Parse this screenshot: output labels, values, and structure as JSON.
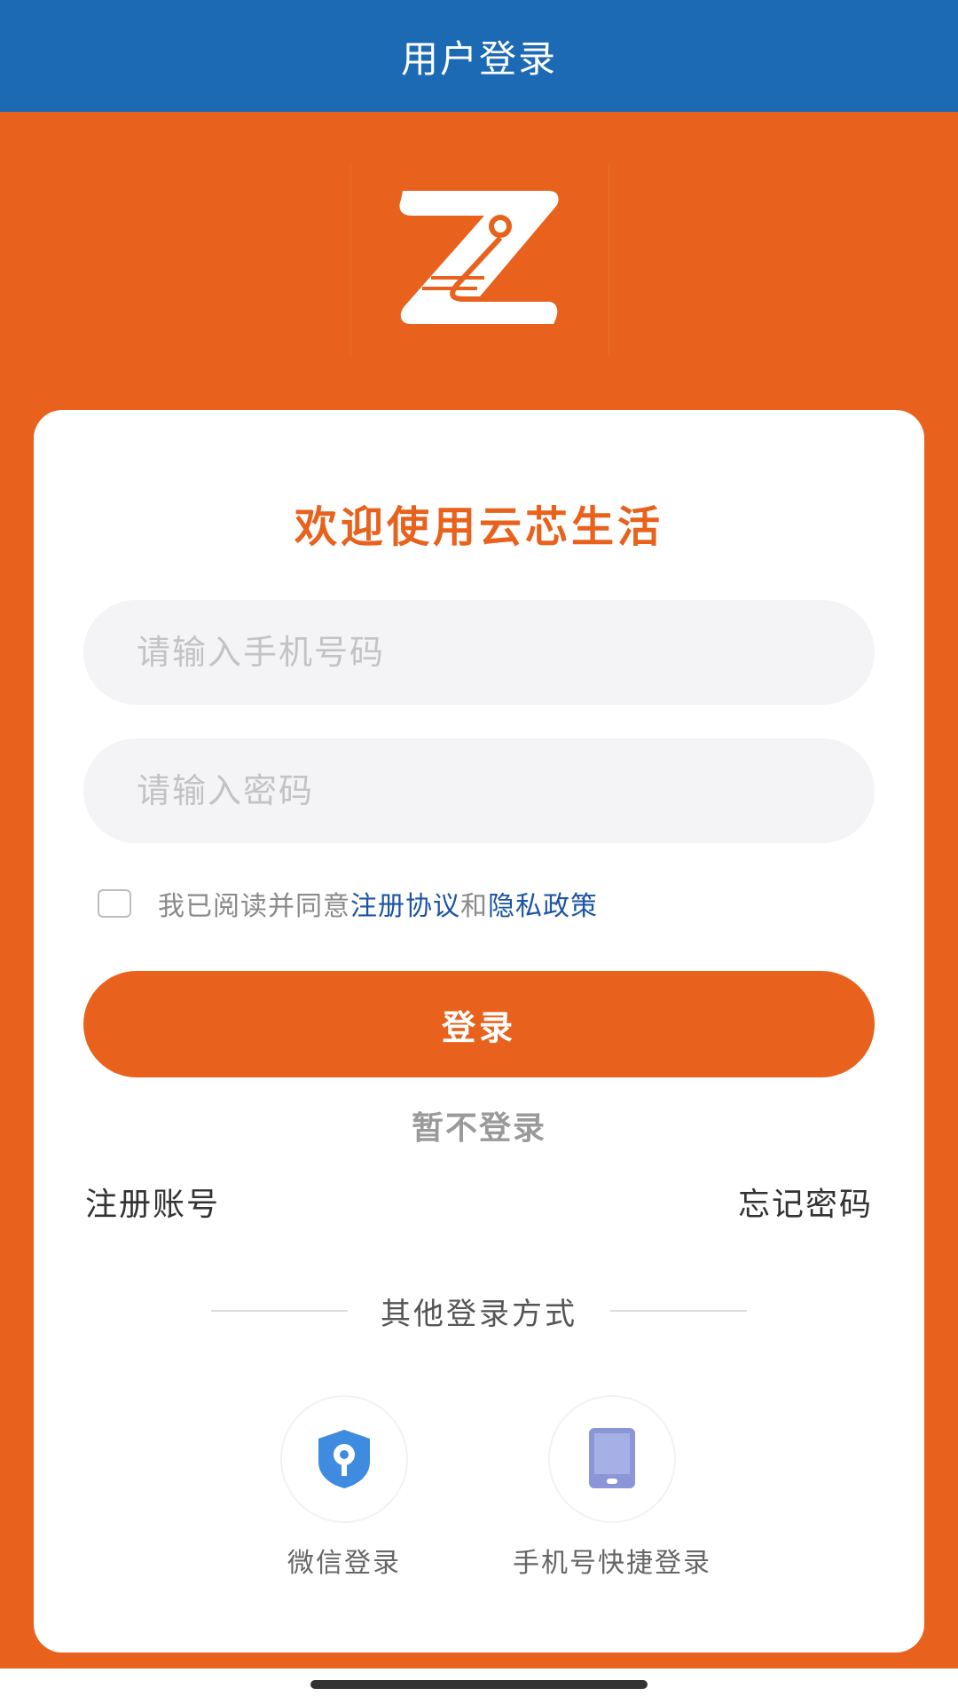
{
  "header": {
    "title": "用户登录"
  },
  "card": {
    "welcome": "欢迎使用云芯生活",
    "phone_placeholder": "请输入手机号码",
    "password_placeholder": "请输入密码",
    "agreement": {
      "prefix": "我已阅读并同意",
      "terms_link": "注册协议",
      "conjunction": "和",
      "privacy_link": "隐私政策",
      "checked": false
    },
    "login_label": "登录",
    "skip_label": "暂不登录",
    "register_label": "注册账号",
    "forgot_label": "忘记密码",
    "other_methods_label": "其他登录方式",
    "alt_methods": [
      {
        "label": "微信登录",
        "icon": "shield-key-icon"
      },
      {
        "label": "手机号快捷登录",
        "icon": "phone-icon"
      }
    ]
  },
  "colors": {
    "header_blue": "#1c69b4",
    "brand_orange": "#e8621d",
    "link_blue": "#1c55a4"
  }
}
